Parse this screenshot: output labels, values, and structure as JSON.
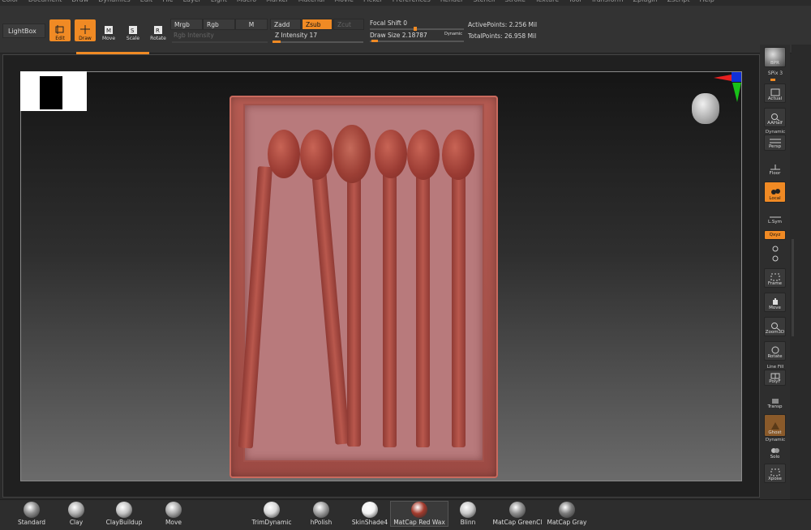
{
  "menu": [
    "Color",
    "Document",
    "Draw",
    "Dynamics",
    "Edit",
    "File",
    "Layer",
    "Light",
    "Macro",
    "Marker",
    "Material",
    "Movie",
    "Picker",
    "Preferences",
    "Render",
    "Stencil",
    "Stroke",
    "Texture",
    "Tool",
    "Transform",
    "Zplugin",
    "Zscript",
    "Help"
  ],
  "toolbar": {
    "lightbox": "LightBox",
    "edit": "Edit",
    "draw": "Draw",
    "move": "Move",
    "scale": "Scale",
    "rotate": "Rotate",
    "mrgb": "Mrgb",
    "rgb": "Rgb",
    "m": "M",
    "rgb_intensity": "Rgb Intensity",
    "zadd": "Zadd",
    "zsub": "Zsub",
    "zcut": "Zcut",
    "z_intensity": "Z Intensity 17",
    "focal_shift": "Focal Shift 0",
    "draw_size": "Draw Size 2.18787",
    "dynamic": "Dynamic",
    "active_points": "ActivePoints: 2.256 Mil",
    "total_points": "TotalPoints: 26.958 Mil"
  },
  "rightshelf": {
    "bpr": "BPR",
    "spix": "SPix 3",
    "actual": "Actual",
    "aahalf": "AAHalf",
    "dynamic": "Dynamic",
    "persp": "Persp",
    "floor": "Floor",
    "local": "Local",
    "lsym": "L.Sym",
    "xyz": "Qxyz",
    "frame": "Frame",
    "move": "Move",
    "zoom3d": "Zoom3D",
    "rotate": "Rotate",
    "line_fill": "Line Fill",
    "polyf": "PolyF",
    "transp": "Transp",
    "ghost": "Ghost",
    "dynamic2": "Dynamic",
    "solo": "Solo",
    "xpose": "Xpose"
  },
  "materials": [
    {
      "label": "Standard",
      "color": "#8a8a8a"
    },
    {
      "label": "Clay",
      "color": "#b0b0b0"
    },
    {
      "label": "ClayBuildup",
      "color": "#c2c2c2"
    },
    {
      "label": "Move",
      "color": "#a8a8a8"
    },
    {
      "label": "TrimDynamic",
      "color": "#d8d8d8"
    },
    {
      "label": "hPolish",
      "color": "#9e9e9e"
    },
    {
      "label": "SkinShade4",
      "color": "#f2f2f2"
    },
    {
      "label": "MatCap Red Wax",
      "color": "#a33a2c"
    },
    {
      "label": "Blinn",
      "color": "#c8c8c8"
    },
    {
      "label": "MatCap GreenCl",
      "color": "#8c8c8c"
    },
    {
      "label": "MatCap Gray",
      "color": "#7a7a7a"
    }
  ],
  "colors": {
    "accent": "#f08a24",
    "wax": "#a33a2c"
  }
}
